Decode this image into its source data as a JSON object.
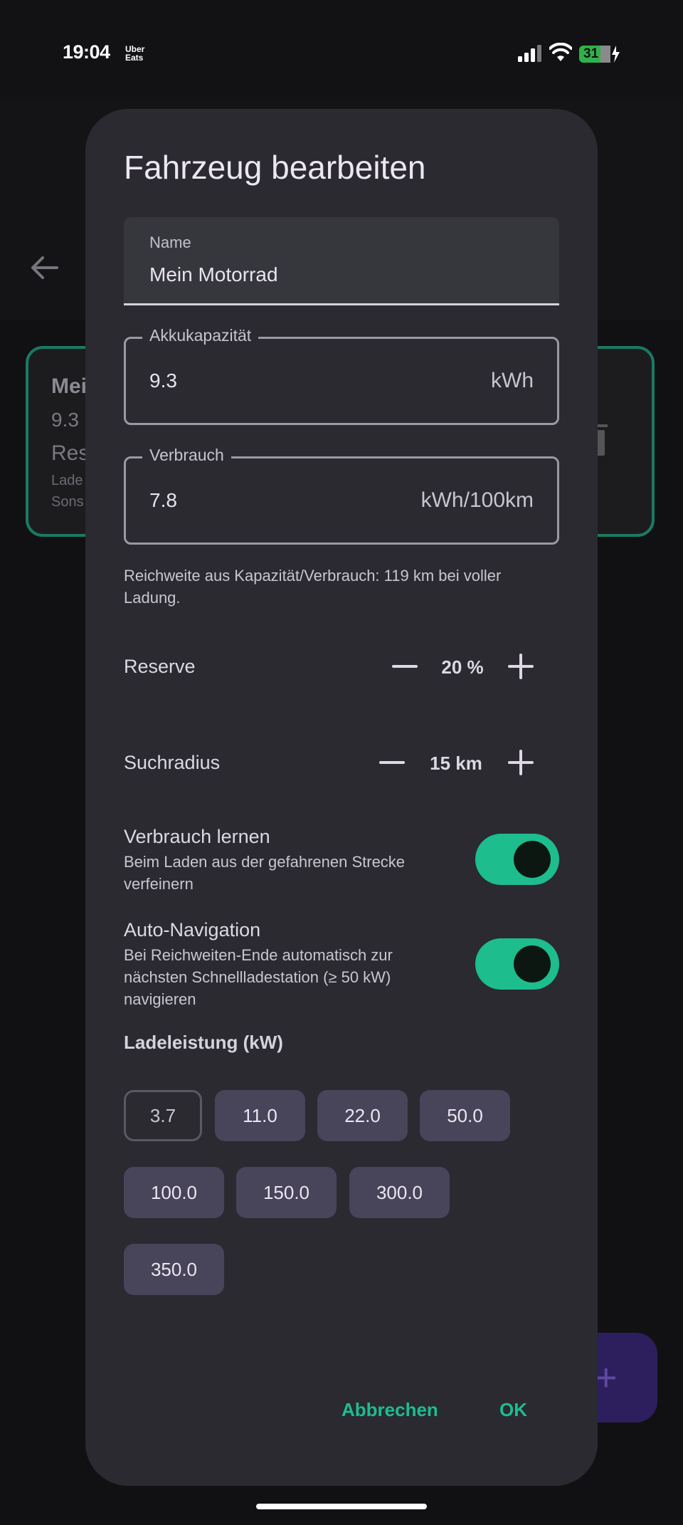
{
  "status_bar": {
    "time": "19:04",
    "app_label_line1": "Uber",
    "app_label_line2": "Eats",
    "battery": "31"
  },
  "background": {
    "card_title": "Mei",
    "card_line2": "9.3",
    "card_line3": "Res",
    "card_line4": "Lade",
    "card_line5": "Sons",
    "fab_label": "+"
  },
  "dialog": {
    "title": "Fahrzeug bearbeiten",
    "name_field": {
      "label": "Name",
      "value": "Mein Motorrad"
    },
    "capacity_field": {
      "label": "Akkukapazität",
      "value": "9.3",
      "unit": "kWh"
    },
    "consumption_field": {
      "label": "Verbrauch",
      "value": "7.8",
      "unit": "kWh/100km"
    },
    "helper_text": "Reichweite aus Kapazität/Verbrauch: 119 km bei voller Ladung.",
    "reserve": {
      "label": "Reserve",
      "value": "20 %"
    },
    "search_radius": {
      "label": "Suchradius",
      "value": "15 km"
    },
    "learn_consumption": {
      "title": "Verbrauch lernen",
      "subtitle": "Beim Laden aus der gefahrenen Strecke verfeinern",
      "on": true
    },
    "auto_navigation": {
      "title": "Auto-Navigation",
      "subtitle": "Bei Reichweiten-Ende automatisch zur nächsten Schnellladestation (≥ 50 kW) navigieren",
      "on": true
    },
    "charging_power_title": "Ladeleistung (kW)",
    "charging_chips": [
      "3.7",
      "11.0",
      "22.0",
      "50.0",
      "100.0",
      "150.0",
      "300.0",
      "350.0"
    ],
    "selected_chip": "3.7",
    "cancel_label": "Abbrechen",
    "ok_label": "OK"
  },
  "colors": {
    "accent": "#1dbd8e",
    "dialog_bg": "#2a2a30",
    "chip_bg": "#48445a",
    "card_border": "#1a7a62"
  },
  "icons": [
    "back-arrow-icon",
    "signal-icon",
    "wifi-icon",
    "battery-icon",
    "trash-icon",
    "minus-icon",
    "plus-icon"
  ]
}
